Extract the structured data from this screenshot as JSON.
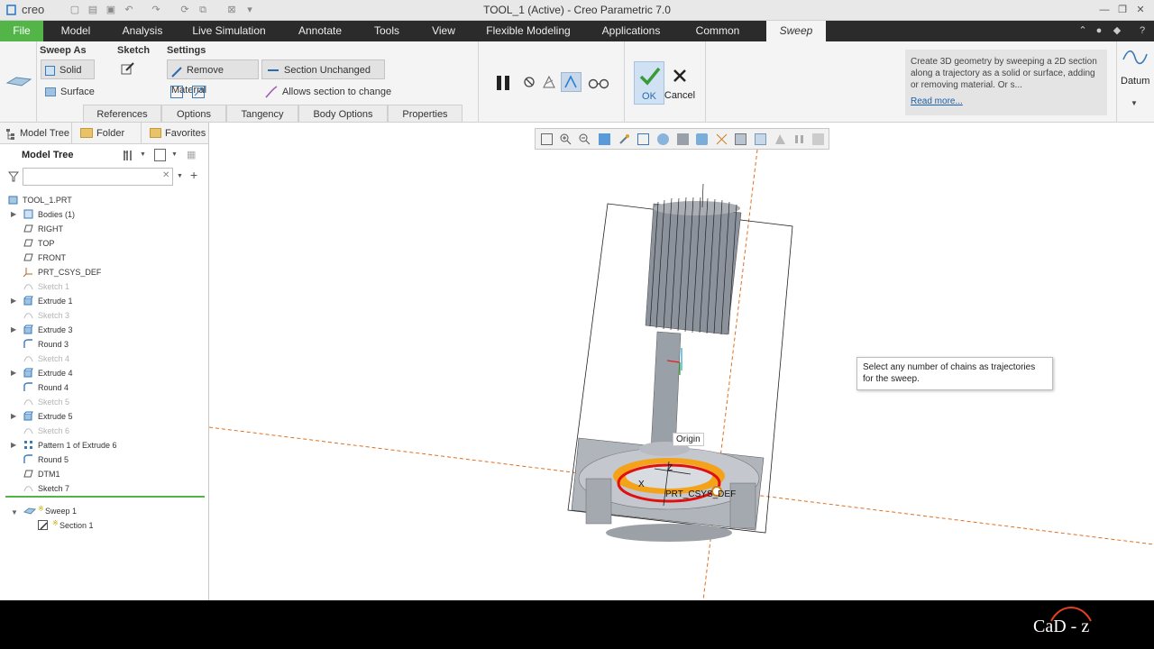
{
  "app": {
    "brand": "creo",
    "window_title": "TOOL_1 (Active) - Creo Parametric 7.0"
  },
  "menu": {
    "file": "File",
    "tabs": [
      "Model",
      "Analysis",
      "Live Simulation",
      "Annotate",
      "Tools",
      "View",
      "Flexible Modeling",
      "Applications",
      "Common"
    ],
    "active": "Sweep"
  },
  "ribbon": {
    "sweep_as": "Sweep As",
    "solid": "Solid",
    "surface": "Surface",
    "sketch": "Sketch",
    "settings": "Settings",
    "remove_material": "Remove Material",
    "section_unchanged": "Section Unchanged",
    "allows_section_change": "Allows section to change",
    "subtabs": [
      "References",
      "Options",
      "Tangency",
      "Body Options",
      "Properties"
    ],
    "ok": "OK",
    "cancel": "Cancel",
    "datum": "Datum"
  },
  "help": {
    "text": "Create 3D geometry by sweeping a 2D section along a trajectory as a solid or surface, adding or removing material. Or s...",
    "link": "Read more..."
  },
  "panel": {
    "tabs": [
      "Model Tree",
      "Folder Bro",
      "Favorites"
    ],
    "header": "Model Tree",
    "search_value": "",
    "items": [
      {
        "label": "TOOL_1.PRT",
        "icon": "part-icon",
        "dim": false,
        "expand": false
      },
      {
        "label": "Bodies (1)",
        "icon": "bodies-icon",
        "dim": false,
        "expand": true
      },
      {
        "label": "RIGHT",
        "icon": "datum-plane-icon",
        "dim": false,
        "expand": false
      },
      {
        "label": "TOP",
        "icon": "datum-plane-icon",
        "dim": false,
        "expand": false
      },
      {
        "label": "FRONT",
        "icon": "datum-plane-icon",
        "dim": false,
        "expand": false
      },
      {
        "label": "PRT_CSYS_DEF",
        "icon": "csys-icon",
        "dim": false,
        "expand": false
      },
      {
        "label": "Sketch 1",
        "icon": "sketch-icon",
        "dim": true,
        "expand": false
      },
      {
        "label": "Extrude 1",
        "icon": "extrude-icon",
        "dim": false,
        "expand": true
      },
      {
        "label": "Sketch 3",
        "icon": "sketch-icon",
        "dim": true,
        "expand": false
      },
      {
        "label": "Extrude 3",
        "icon": "extrude-icon",
        "dim": false,
        "expand": true
      },
      {
        "label": "Round 3",
        "icon": "round-icon",
        "dim": false,
        "expand": false
      },
      {
        "label": "Sketch 4",
        "icon": "sketch-icon",
        "dim": true,
        "expand": false
      },
      {
        "label": "Extrude 4",
        "icon": "extrude-icon",
        "dim": false,
        "expand": true
      },
      {
        "label": "Round 4",
        "icon": "round-icon",
        "dim": false,
        "expand": false
      },
      {
        "label": "Sketch 5",
        "icon": "sketch-icon",
        "dim": true,
        "expand": false
      },
      {
        "label": "Extrude 5",
        "icon": "extrude-icon",
        "dim": false,
        "expand": true
      },
      {
        "label": "Sketch 6",
        "icon": "sketch-icon",
        "dim": true,
        "expand": false
      },
      {
        "label": "Pattern 1 of Extrude 6",
        "icon": "pattern-icon",
        "dim": false,
        "expand": true
      },
      {
        "label": "Round 5",
        "icon": "round-icon",
        "dim": false,
        "expand": false
      },
      {
        "label": "DTM1",
        "icon": "datum-plane-icon",
        "dim": false,
        "expand": false
      },
      {
        "label": "Sketch 7",
        "icon": "sketch-icon",
        "dim": false,
        "expand": false
      }
    ],
    "sweep": "Sweep 1",
    "section": "Section 1"
  },
  "viewport": {
    "origin_label": "Origin",
    "csys_label": "PRT_CSYS_DEF",
    "axis_x": "X",
    "axis_z": "Z"
  },
  "tooltip": "Select any number of chains as trajectories for the sweep.",
  "watermark": "CaD - z",
  "colors": {
    "file_tab": "#53b548",
    "menubar": "#2b2b2b",
    "trajectory": "#e01010",
    "highlight": "#f4a21a",
    "datum_line": "#e07020"
  }
}
